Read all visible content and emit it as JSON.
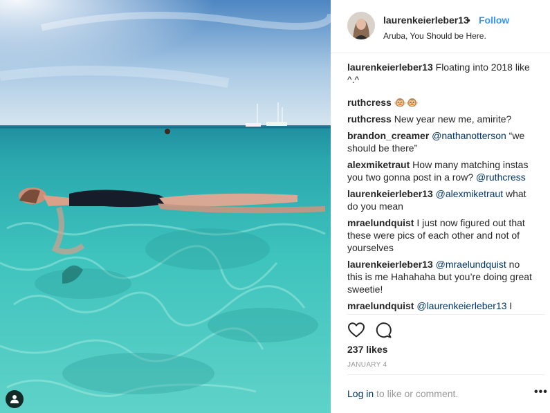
{
  "post": {
    "owner": "laurenkeierleber13",
    "separator": "•",
    "follow_label": "Follow",
    "location": "Aruba, You Should be Here."
  },
  "comments": [
    {
      "user": "laurenkeierleber13",
      "text": " Floating into 2018 like ^.^"
    },
    {
      "user": "ruthcress",
      "text": " 🐵🐵"
    },
    {
      "user": "ruthcress",
      "text": " New year new me, amirite?"
    },
    {
      "user": "brandon_creamer",
      "mention": "@nathanotterson",
      "text": " “we should be there”"
    },
    {
      "user": "alexmiketraut",
      "pre": " How many matching instas you two gonna post in a row? ",
      "mention": "@ruthcress"
    },
    {
      "user": "laurenkeierleber13",
      "mention": "@alexmiketraut",
      "text": " what do you mean"
    },
    {
      "user": "mraelundquist",
      "text": " I just now figured out that these were pics of each other and not of yourselves"
    },
    {
      "user": "laurenkeierleber13",
      "mention": "@mraelundquist",
      "text": " no this is me Hahahaha but you’re doing great sweetie!"
    },
    {
      "user": "mraelundquist",
      "mention": "@laurenkeierleber13",
      "text": " I CANT HANDLE THIS IT IS TOO CONFUSING"
    }
  ],
  "actions": {
    "like_icon": "heart-icon",
    "comment_icon": "speech-bubble-icon"
  },
  "likes": "237 likes",
  "date": "JANUARY 4",
  "footer": {
    "login_label": "Log in",
    "login_suffix": " to like or comment.",
    "more_label": "•••"
  },
  "colors": {
    "follow": "#3897f0",
    "mention": "#003569",
    "muted": "#999999",
    "border": "#efefef"
  }
}
